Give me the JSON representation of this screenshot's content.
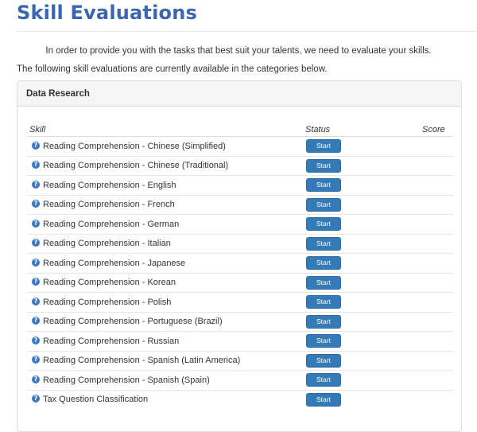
{
  "page": {
    "title": "Skill Evaluations",
    "intro": "In order to provide you with the tasks that best suit your talents, we need to evaluate your skills.",
    "available_text": "The following skill evaluations are currently available in the categories below."
  },
  "panel": {
    "heading": "Data Research",
    "columns": {
      "skill": "Skill",
      "status": "Status",
      "score": "Score"
    },
    "rows": [
      {
        "skill": "Reading Comprehension - Chinese (Simplified)",
        "status": "Start",
        "score": ""
      },
      {
        "skill": "Reading Comprehension - Chinese (Traditional)",
        "status": "Start",
        "score": ""
      },
      {
        "skill": "Reading Comprehension - English",
        "status": "Start",
        "score": ""
      },
      {
        "skill": "Reading Comprehension - French",
        "status": "Start",
        "score": ""
      },
      {
        "skill": "Reading Comprehension - German",
        "status": "Start",
        "score": ""
      },
      {
        "skill": "Reading Comprehension - Italian",
        "status": "Start",
        "score": ""
      },
      {
        "skill": "Reading Comprehension - Japanese",
        "status": "Start",
        "score": ""
      },
      {
        "skill": "Reading Comprehension - Korean",
        "status": "Start",
        "score": ""
      },
      {
        "skill": "Reading Comprehension - Polish",
        "status": "Start",
        "score": ""
      },
      {
        "skill": "Reading Comprehension - Portuguese (Brazil)",
        "status": "Start",
        "score": ""
      },
      {
        "skill": "Reading Comprehension - Russian",
        "status": "Start",
        "score": ""
      },
      {
        "skill": "Reading Comprehension - Spanish (Latin America)",
        "status": "Start",
        "score": ""
      },
      {
        "skill": "Reading Comprehension - Spanish (Spain)",
        "status": "Start",
        "score": ""
      },
      {
        "skill": "Tax Question Classification",
        "status": "Start",
        "score": ""
      }
    ]
  },
  "icons": {
    "info": "question-circle-icon"
  },
  "colors": {
    "title": "#3a65b0",
    "button": "#337ab7",
    "info_icon": "#3a78c3"
  }
}
